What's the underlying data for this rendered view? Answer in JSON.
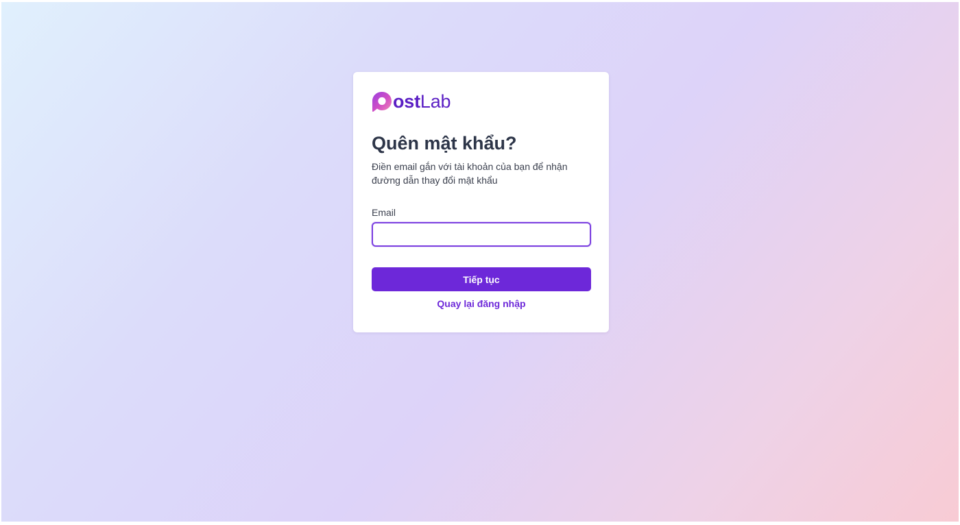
{
  "brand": {
    "logo_icon": "speech-bubble-p-icon",
    "name_bold": "ost",
    "name_light": "Lab",
    "color": "#5b1fc4"
  },
  "form": {
    "title": "Quên mật khẩu?",
    "description": "Điền email gắn với tài khoản của bạn để nhận đường dẫn thay đổi mật khẩu",
    "email_label": "Email",
    "email_value": "",
    "submit_label": "Tiếp tục",
    "back_link_label": "Quay lại đăng nhập"
  },
  "colors": {
    "accent": "#6d28d9",
    "input_focus_border": "#7b3fe0",
    "heading": "#2d3548"
  }
}
